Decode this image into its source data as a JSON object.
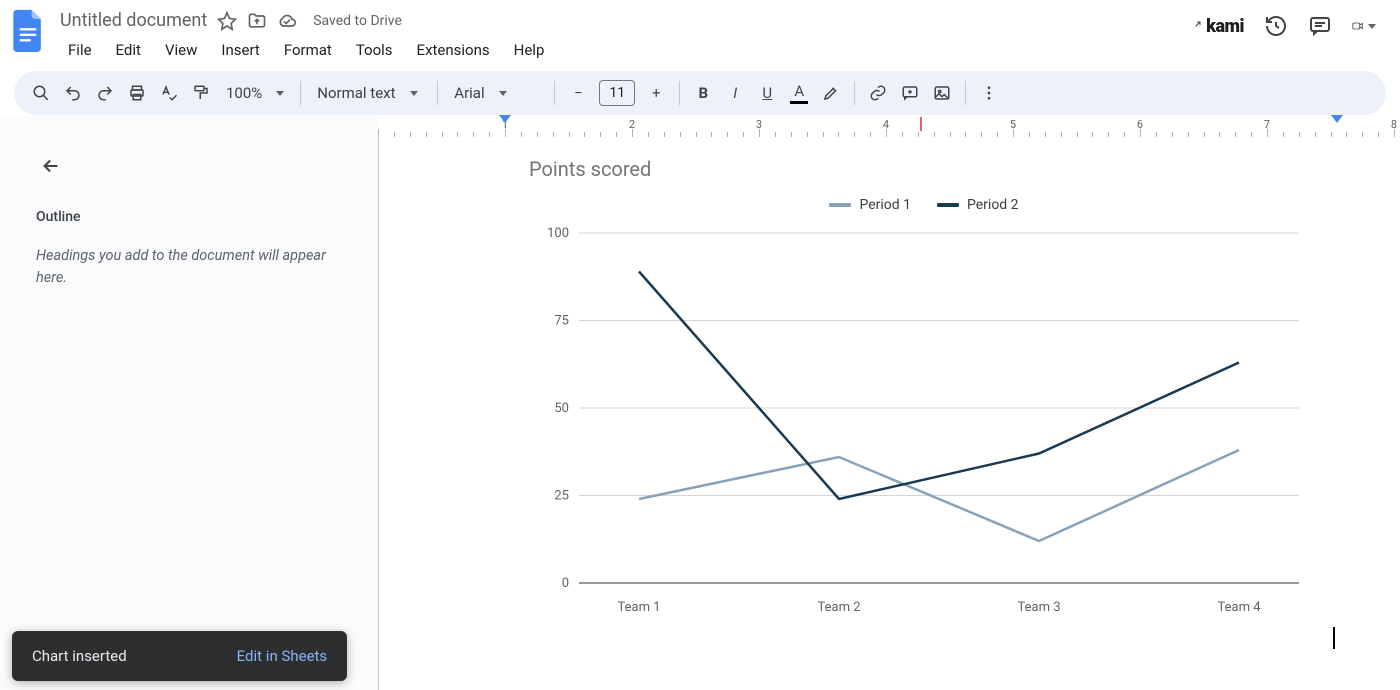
{
  "header": {
    "doc_title": "Untitled document",
    "saved": "Saved to Drive",
    "menus": [
      "File",
      "Edit",
      "View",
      "Insert",
      "Format",
      "Tools",
      "Extensions",
      "Help"
    ],
    "kami_label": "kami"
  },
  "toolbar": {
    "zoom": "100%",
    "style": "Normal text",
    "font": "Arial",
    "font_size": "11"
  },
  "sidebar": {
    "outline_header": "Outline",
    "outline_empty": "Headings you add to the document will appear here."
  },
  "toast": {
    "message": "Chart inserted",
    "action": "Edit in Sheets"
  },
  "colors": {
    "period1": "#89a2b8",
    "period2": "#1a3a52"
  },
  "chart_data": {
    "type": "line",
    "title": "Points scored",
    "categories": [
      "Team 1",
      "Team 2",
      "Team 3",
      "Team 4"
    ],
    "series": [
      {
        "name": "Period 1",
        "values": [
          24,
          36,
          12,
          38
        ]
      },
      {
        "name": "Period 2",
        "values": [
          89,
          24,
          37,
          63
        ]
      }
    ],
    "ylabel": "",
    "xlabel": "",
    "ylim": [
      0,
      100
    ],
    "yticks": [
      0,
      25,
      50,
      75,
      100
    ]
  }
}
